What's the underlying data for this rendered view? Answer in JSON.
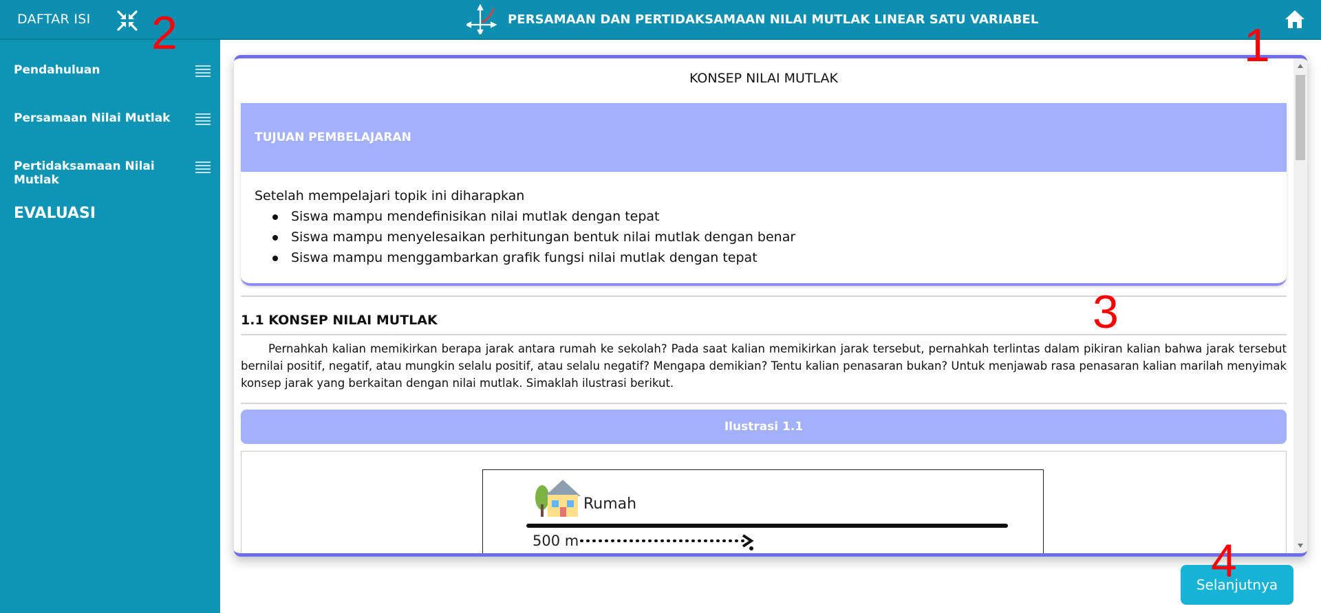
{
  "header": {
    "toc_label": "DAFTAR ISI",
    "title": "PERSAMAAN DAN PERTIDAKSAMAAN NILAI MUTLAK LINEAR SATU VARIABEL"
  },
  "sidebar": {
    "items": [
      {
        "label": "Pendahuluan"
      },
      {
        "label": "Persamaan Nilai Mutlak"
      },
      {
        "label": "Pertidaksamaan Nilai Mutlak"
      }
    ],
    "evaluation_label": "EVALUASI"
  },
  "content": {
    "heading": "KONSEP NILAI MUTLAK",
    "goals": {
      "title": "TUJUAN PEMBELAJARAN",
      "intro": "Setelah mempelajari topik ini diharapkan",
      "items": [
        "Siswa mampu mendefinisikan nilai mutlak dengan tepat",
        "Siswa mampu menyelesaikan perhitungan bentuk nilai mutlak dengan benar",
        "Siswa mampu menggambarkan grafik fungsi nilai mutlak dengan tepat"
      ]
    },
    "section_title": "1.1 KONSEP NILAI MUTLAK",
    "paragraph": "Pernahkah kalian memikirkan berapa jarak antara rumah ke sekolah? Pada saat kalian memikirkan jarak tersebut, pernahkah terlintas dalam pikiran kalian bahwa jarak tersebut bernilai positif, negatif, atau mungkin selalu positif, atau selalu negatif? Mengapa demikian? Tentu kalian penasaran bukan? Untuk menjawab rasa penasaran kalian marilah menyimak konsep jarak yang berkaitan dengan nilai mutlak. Simaklah ilustrasi berikut.",
    "illustration": {
      "title": "Ilustrasi 1.1",
      "house_label": "Rumah",
      "distance_label": "500 m"
    }
  },
  "next_button": "Selanjutnya",
  "markers": [
    "1",
    "2",
    "3",
    "4"
  ],
  "colors": {
    "header": "#0e8fb1",
    "sidebar": "#0e95b5",
    "card_accent": "#6f6cf0",
    "section_header": "#a3b0fb",
    "button": "#17b3d6",
    "marker": "#ff0000"
  }
}
